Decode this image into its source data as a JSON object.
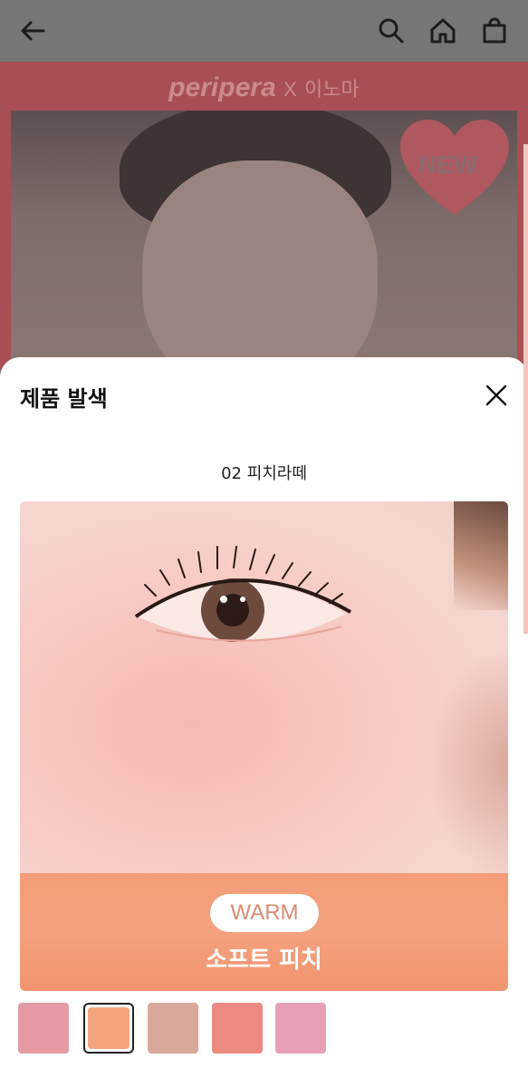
{
  "appbar": {
    "back_icon": "arrow-left-icon",
    "search_icon": "search-icon",
    "home_icon": "home-icon",
    "cart_icon": "shopping-bag-icon"
  },
  "banner": {
    "brand": "peripera",
    "collab_x": "X",
    "collab_name": "이노마",
    "badge": "NEW"
  },
  "sheet": {
    "title": "제품 발색",
    "close_icon": "close-icon",
    "shade_name": "02 피치라떼",
    "swatch_tag": "WARM",
    "swatch_label": "소프트 피치",
    "thumbnails": [
      {
        "color": "#e59aa5",
        "selected": false
      },
      {
        "color": "#f2a57c",
        "selected": true
      },
      {
        "color": "#d8a99a",
        "selected": false
      },
      {
        "color": "#ec8a80",
        "selected": false
      },
      {
        "color": "#e7a0b3",
        "selected": false
      }
    ]
  }
}
